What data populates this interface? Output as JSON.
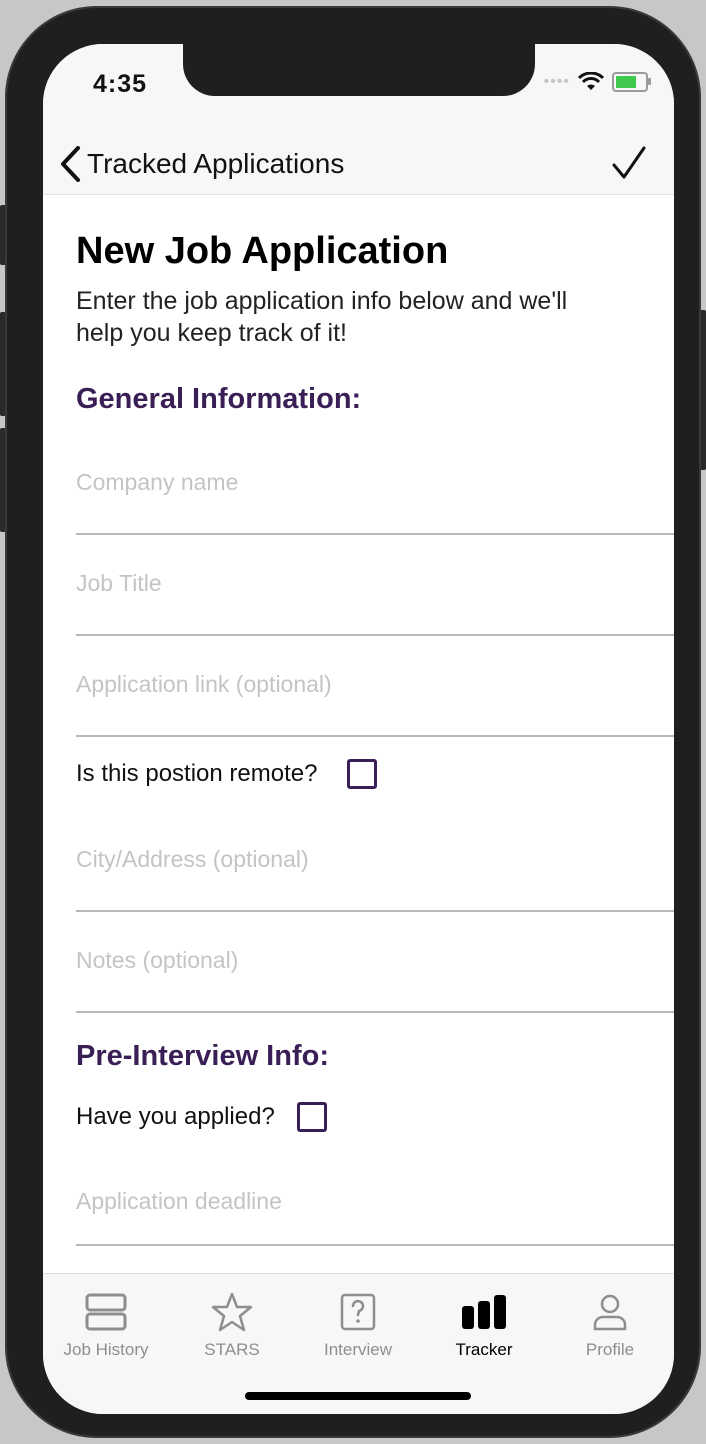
{
  "status": {
    "time": "4:35"
  },
  "nav": {
    "back_label": "Tracked Applications"
  },
  "page": {
    "title": "New Job Application",
    "subtitle": "Enter the job application info below and we'll help you keep track of it!"
  },
  "general": {
    "heading": "General Information:",
    "company_placeholder": "Company name",
    "job_title_placeholder": "Job Title",
    "link_placeholder": "Application link (optional)",
    "remote_label": "Is this postion remote?",
    "remote_checked": false,
    "address_placeholder": "City/Address (optional)",
    "notes_placeholder": "Notes (optional)"
  },
  "pre_interview": {
    "heading": "Pre-Interview Info:",
    "applied_label": "Have you applied?",
    "applied_checked": false,
    "deadline_placeholder": "Application deadline"
  },
  "tabs": [
    {
      "label": "Job History",
      "icon": "job-history-icon",
      "active": false
    },
    {
      "label": "STARS",
      "icon": "star-icon",
      "active": false
    },
    {
      "label": "Interview",
      "icon": "question-icon",
      "active": false
    },
    {
      "label": "Tracker",
      "icon": "bar-chart-icon",
      "active": true
    },
    {
      "label": "Profile",
      "icon": "person-icon",
      "active": false
    }
  ],
  "colors": {
    "accent": "#3a1f56",
    "placeholder": "#c4c4c4",
    "battery": "#3fc84c"
  }
}
